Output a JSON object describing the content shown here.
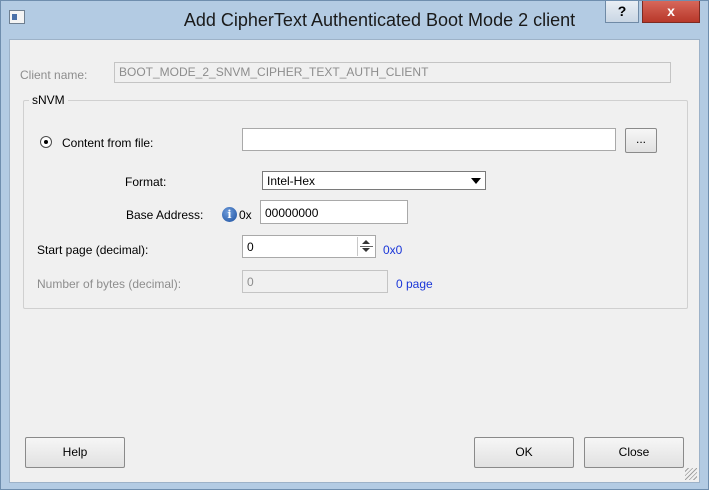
{
  "window": {
    "title": "Add CipherText Authenticated Boot Mode 2 client",
    "help_glyph": "?",
    "close_glyph": "x"
  },
  "client_name": {
    "label": "Client name:",
    "value": "BOOT_MODE_2_SNVM_CIPHER_TEXT_AUTH_CLIENT"
  },
  "snvm_group": {
    "title": "sNVM",
    "content_from_file": {
      "label": "Content from file:",
      "value": "",
      "browse_label": "..."
    },
    "format": {
      "label": "Format:",
      "selected": "Intel-Hex"
    },
    "base_address": {
      "label": "Base Address:",
      "prefix": "0x",
      "value": "00000000"
    },
    "start_page": {
      "label": "Start page (decimal):",
      "value": "0",
      "hex": "0x0"
    },
    "num_bytes": {
      "label": "Number of bytes (decimal):",
      "value": "0",
      "pages": "0 page"
    }
  },
  "footer": {
    "help_label": "Help",
    "ok_label": "OK",
    "close_label": "Close"
  },
  "icons": {
    "info_glyph": "i"
  }
}
